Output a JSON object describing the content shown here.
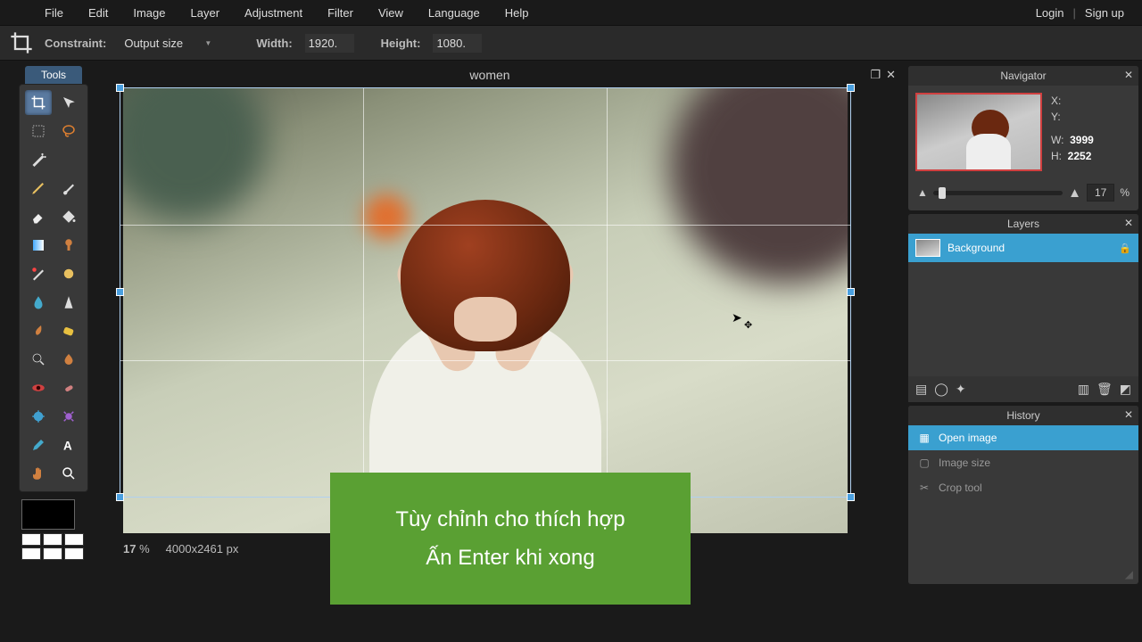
{
  "menu": {
    "items": [
      "File",
      "Edit",
      "Image",
      "Layer",
      "Adjustment",
      "Filter",
      "View",
      "Language",
      "Help"
    ]
  },
  "auth": {
    "login": "Login",
    "signup": "Sign up"
  },
  "options": {
    "constraint_label": "Constraint:",
    "constraint_value": "Output size",
    "width_label": "Width:",
    "width_value": "1920.",
    "height_label": "Height:",
    "height_value": "1080."
  },
  "tools": {
    "title": "Tools"
  },
  "document": {
    "title": "women"
  },
  "status": {
    "zoom": "17",
    "zoom_unit": "%",
    "dims": "4000x2461 px"
  },
  "tip": {
    "line1": "Tùy chỉnh cho thích hợp",
    "line2": "Ấn Enter khi xong"
  },
  "navigator": {
    "title": "Navigator",
    "x_label": "X:",
    "y_label": "Y:",
    "w_label": "W:",
    "w_value": "3999",
    "h_label": "H:",
    "h_value": "2252",
    "zoom": "17",
    "zoom_unit": "%"
  },
  "layers": {
    "title": "Layers",
    "background": "Background"
  },
  "history": {
    "title": "History",
    "items": [
      {
        "label": "Open image",
        "active": true
      },
      {
        "label": "Image size",
        "active": false
      },
      {
        "label": "Crop tool",
        "active": false
      }
    ]
  }
}
